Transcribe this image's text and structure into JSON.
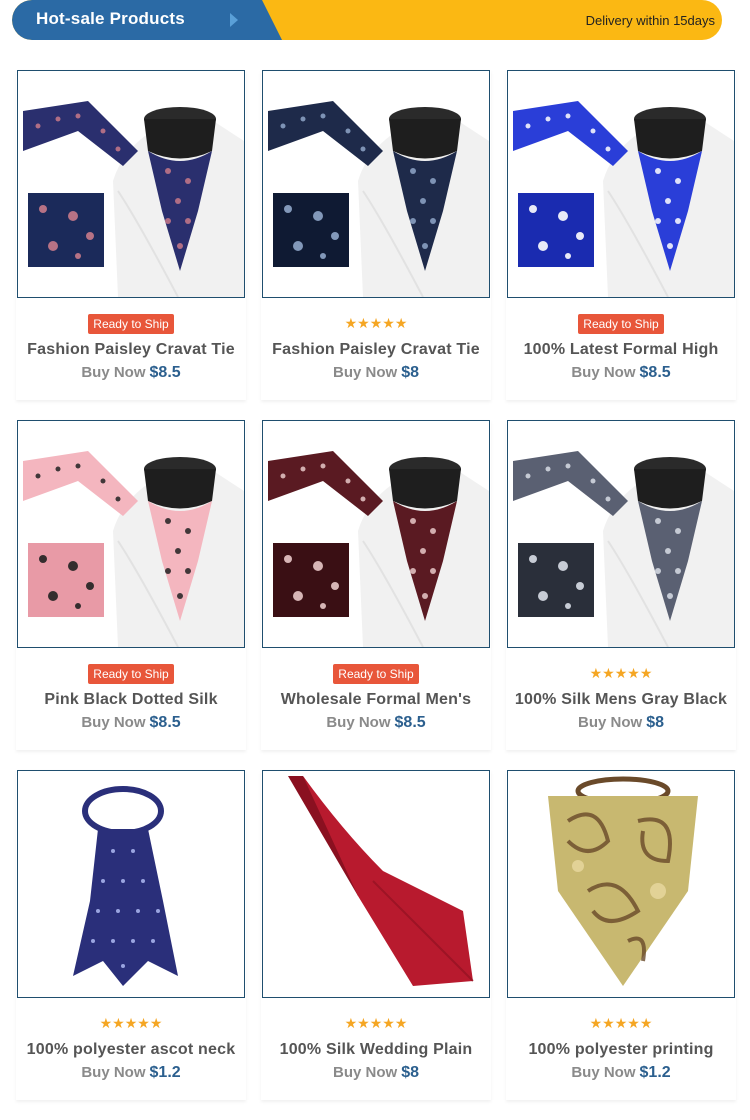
{
  "header": {
    "title": "Hot-sale Products",
    "delivery": "Delivery within 15days"
  },
  "colors": {
    "banner_blue": "#2b6aa5",
    "banner_yellow": "#fbb813",
    "badge_red": "#e8563a",
    "star_gold": "#f5a623",
    "price_blue": "#2b5f8e"
  },
  "products": [
    {
      "name": "Fashion Paisley Cravat Tie",
      "buy_label": "Buy Now",
      "price": "$8.5",
      "tag": "Ready to Ship",
      "stars": "",
      "palette": [
        "#2a2f6e",
        "#c87a8a",
        "#1b2a5a"
      ]
    },
    {
      "name": "Fashion Paisley Cravat Tie",
      "buy_label": "Buy Now",
      "price": "$8",
      "tag": "",
      "stars": "★★★★★",
      "palette": [
        "#1e2a4a",
        "#8fa6c8",
        "#0f1a33"
      ]
    },
    {
      "name": "100% Latest Formal High",
      "buy_label": "Buy Now",
      "price": "$8.5",
      "tag": "Ready to Ship",
      "stars": "",
      "palette": [
        "#2a3ed8",
        "#ffffff",
        "#1a2bb0"
      ]
    },
    {
      "name": "Pink Black Dotted Silk",
      "buy_label": "Buy Now",
      "price": "$8.5",
      "tag": "Ready to Ship",
      "stars": "",
      "palette": [
        "#f4b6bf",
        "#222222",
        "#e89aa6"
      ]
    },
    {
      "name": "Wholesale Formal Men's",
      "buy_label": "Buy Now",
      "price": "$8.5",
      "tag": "Ready to Ship",
      "stars": "",
      "palette": [
        "#5a1a22",
        "#e8c8c8",
        "#3a0f14"
      ]
    },
    {
      "name": "100% Silk Mens Gray Black",
      "buy_label": "Buy Now",
      "price": "$8",
      "tag": "",
      "stars": "★★★★★",
      "palette": [
        "#5a6072",
        "#d8dde6",
        "#2a2f3a"
      ]
    },
    {
      "name": "100% polyester ascot neck",
      "buy_label": "Buy Now",
      "price": "$1.2",
      "tag": "",
      "stars": "★★★★★",
      "palette": [
        "#2a2f7a",
        "#9aa4e0",
        "#1a1f5a"
      ]
    },
    {
      "name": "100% Silk Wedding Plain",
      "buy_label": "Buy Now",
      "price": "$8",
      "tag": "",
      "stars": "★★★★★",
      "palette": [
        "#b81a2e",
        "#c8283c",
        "#8a1020"
      ]
    },
    {
      "name": "100% polyester printing",
      "buy_label": "Buy Now",
      "price": "$1.2",
      "tag": "",
      "stars": "★★★★★",
      "palette": [
        "#c8b870",
        "#6a4a2a",
        "#e8d8a0"
      ]
    }
  ]
}
